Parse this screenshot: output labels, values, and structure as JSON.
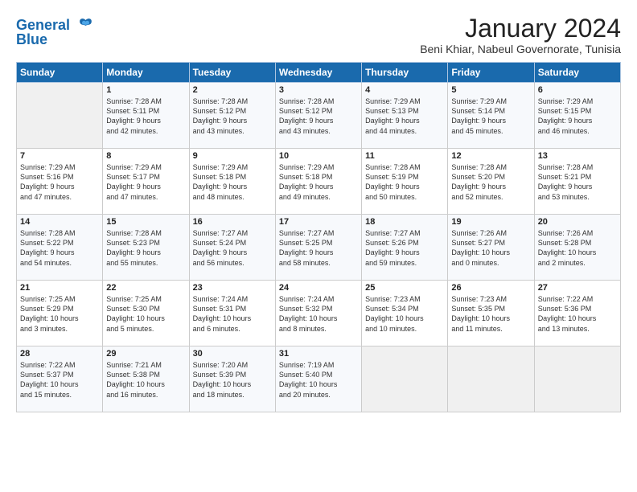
{
  "logo": {
    "line1": "General",
    "line2": "Blue"
  },
  "title": "January 2024",
  "location": "Beni Khiar, Nabeul Governorate, Tunisia",
  "headers": [
    "Sunday",
    "Monday",
    "Tuesday",
    "Wednesday",
    "Thursday",
    "Friday",
    "Saturday"
  ],
  "weeks": [
    [
      {
        "day": "",
        "info": ""
      },
      {
        "day": "1",
        "info": "Sunrise: 7:28 AM\nSunset: 5:11 PM\nDaylight: 9 hours\nand 42 minutes."
      },
      {
        "day": "2",
        "info": "Sunrise: 7:28 AM\nSunset: 5:12 PM\nDaylight: 9 hours\nand 43 minutes."
      },
      {
        "day": "3",
        "info": "Sunrise: 7:28 AM\nSunset: 5:12 PM\nDaylight: 9 hours\nand 43 minutes."
      },
      {
        "day": "4",
        "info": "Sunrise: 7:29 AM\nSunset: 5:13 PM\nDaylight: 9 hours\nand 44 minutes."
      },
      {
        "day": "5",
        "info": "Sunrise: 7:29 AM\nSunset: 5:14 PM\nDaylight: 9 hours\nand 45 minutes."
      },
      {
        "day": "6",
        "info": "Sunrise: 7:29 AM\nSunset: 5:15 PM\nDaylight: 9 hours\nand 46 minutes."
      }
    ],
    [
      {
        "day": "7",
        "info": "Sunrise: 7:29 AM\nSunset: 5:16 PM\nDaylight: 9 hours\nand 47 minutes."
      },
      {
        "day": "8",
        "info": "Sunrise: 7:29 AM\nSunset: 5:17 PM\nDaylight: 9 hours\nand 47 minutes."
      },
      {
        "day": "9",
        "info": "Sunrise: 7:29 AM\nSunset: 5:18 PM\nDaylight: 9 hours\nand 48 minutes."
      },
      {
        "day": "10",
        "info": "Sunrise: 7:29 AM\nSunset: 5:18 PM\nDaylight: 9 hours\nand 49 minutes."
      },
      {
        "day": "11",
        "info": "Sunrise: 7:28 AM\nSunset: 5:19 PM\nDaylight: 9 hours\nand 50 minutes."
      },
      {
        "day": "12",
        "info": "Sunrise: 7:28 AM\nSunset: 5:20 PM\nDaylight: 9 hours\nand 52 minutes."
      },
      {
        "day": "13",
        "info": "Sunrise: 7:28 AM\nSunset: 5:21 PM\nDaylight: 9 hours\nand 53 minutes."
      }
    ],
    [
      {
        "day": "14",
        "info": "Sunrise: 7:28 AM\nSunset: 5:22 PM\nDaylight: 9 hours\nand 54 minutes."
      },
      {
        "day": "15",
        "info": "Sunrise: 7:28 AM\nSunset: 5:23 PM\nDaylight: 9 hours\nand 55 minutes."
      },
      {
        "day": "16",
        "info": "Sunrise: 7:27 AM\nSunset: 5:24 PM\nDaylight: 9 hours\nand 56 minutes."
      },
      {
        "day": "17",
        "info": "Sunrise: 7:27 AM\nSunset: 5:25 PM\nDaylight: 9 hours\nand 58 minutes."
      },
      {
        "day": "18",
        "info": "Sunrise: 7:27 AM\nSunset: 5:26 PM\nDaylight: 9 hours\nand 59 minutes."
      },
      {
        "day": "19",
        "info": "Sunrise: 7:26 AM\nSunset: 5:27 PM\nDaylight: 10 hours\nand 0 minutes."
      },
      {
        "day": "20",
        "info": "Sunrise: 7:26 AM\nSunset: 5:28 PM\nDaylight: 10 hours\nand 2 minutes."
      }
    ],
    [
      {
        "day": "21",
        "info": "Sunrise: 7:25 AM\nSunset: 5:29 PM\nDaylight: 10 hours\nand 3 minutes."
      },
      {
        "day": "22",
        "info": "Sunrise: 7:25 AM\nSunset: 5:30 PM\nDaylight: 10 hours\nand 5 minutes."
      },
      {
        "day": "23",
        "info": "Sunrise: 7:24 AM\nSunset: 5:31 PM\nDaylight: 10 hours\nand 6 minutes."
      },
      {
        "day": "24",
        "info": "Sunrise: 7:24 AM\nSunset: 5:32 PM\nDaylight: 10 hours\nand 8 minutes."
      },
      {
        "day": "25",
        "info": "Sunrise: 7:23 AM\nSunset: 5:34 PM\nDaylight: 10 hours\nand 10 minutes."
      },
      {
        "day": "26",
        "info": "Sunrise: 7:23 AM\nSunset: 5:35 PM\nDaylight: 10 hours\nand 11 minutes."
      },
      {
        "day": "27",
        "info": "Sunrise: 7:22 AM\nSunset: 5:36 PM\nDaylight: 10 hours\nand 13 minutes."
      }
    ],
    [
      {
        "day": "28",
        "info": "Sunrise: 7:22 AM\nSunset: 5:37 PM\nDaylight: 10 hours\nand 15 minutes."
      },
      {
        "day": "29",
        "info": "Sunrise: 7:21 AM\nSunset: 5:38 PM\nDaylight: 10 hours\nand 16 minutes."
      },
      {
        "day": "30",
        "info": "Sunrise: 7:20 AM\nSunset: 5:39 PM\nDaylight: 10 hours\nand 18 minutes."
      },
      {
        "day": "31",
        "info": "Sunrise: 7:19 AM\nSunset: 5:40 PM\nDaylight: 10 hours\nand 20 minutes."
      },
      {
        "day": "",
        "info": ""
      },
      {
        "day": "",
        "info": ""
      },
      {
        "day": "",
        "info": ""
      }
    ]
  ]
}
